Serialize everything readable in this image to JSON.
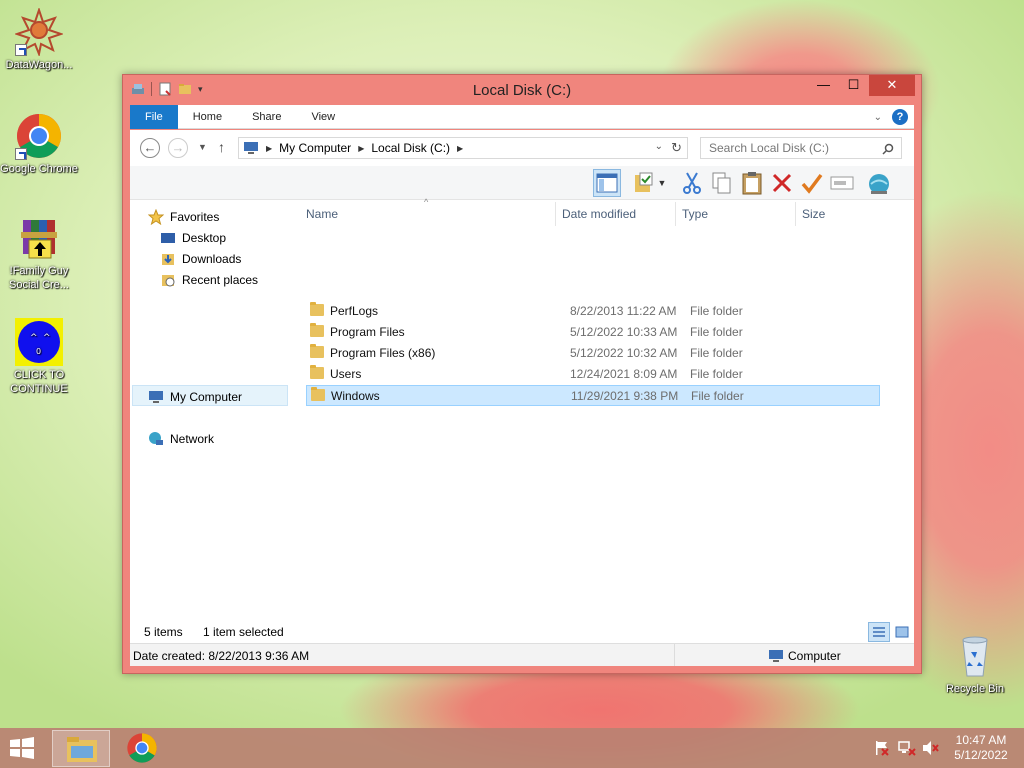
{
  "desktop": {
    "icons": [
      {
        "label": "DataWagon...",
        "icon": "datawagon-mandala-icon"
      },
      {
        "label": "Google Chrome",
        "icon": "chrome-icon"
      },
      {
        "label": "!Family Guy Social Cre...",
        "icon": "winrar-archive-icon"
      },
      {
        "label": "CLICK TO CONTINUE",
        "icon": "blue-face-icon"
      },
      {
        "label": "Recycle Bin",
        "icon": "recycle-bin-icon"
      }
    ]
  },
  "window": {
    "title": "Local Disk (C:)",
    "controls": {
      "minimize": "—",
      "maximize": "☐",
      "close": "✕"
    },
    "ribbon_tabs": [
      "File",
      "Home",
      "Share",
      "View"
    ],
    "nav": {
      "back": "←",
      "forward": "→",
      "up": "↑"
    },
    "breadcrumb": [
      "My Computer",
      "Local Disk (C:)"
    ],
    "search_placeholder": "Search Local Disk (C:)",
    "navigation_pane": {
      "favorites_label": "Favorites",
      "favorites": [
        "Desktop",
        "Downloads",
        "Recent places"
      ],
      "computer_label": "My Computer",
      "network_label": "Network"
    },
    "columns": [
      "Name",
      "Date modified",
      "Type",
      "Size"
    ],
    "files": [
      {
        "name": "PerfLogs",
        "date": "8/22/2013 11:22 AM",
        "type": "File folder",
        "selected": false
      },
      {
        "name": "Program Files",
        "date": "5/12/2022 10:33 AM",
        "type": "File folder",
        "selected": false
      },
      {
        "name": "Program Files (x86)",
        "date": "5/12/2022 10:32 AM",
        "type": "File folder",
        "selected": false
      },
      {
        "name": "Users",
        "date": "12/24/2021 8:09 AM",
        "type": "File folder",
        "selected": false
      },
      {
        "name": "Windows",
        "date": "11/29/2021 9:38 PM",
        "type": "File folder",
        "selected": true
      }
    ],
    "status": {
      "items": "5 items",
      "selected": "1 item selected"
    },
    "details": {
      "date_created": "Date created: 8/22/2013 9:36 AM",
      "location": "Computer"
    }
  },
  "taskbar": {
    "time": "10:47 AM",
    "date": "5/12/2022"
  },
  "colors": {
    "window_frame": "#f0857d",
    "file_tab": "#1979ca",
    "selection": "#cce8ff",
    "taskbar": "#ba8172"
  }
}
